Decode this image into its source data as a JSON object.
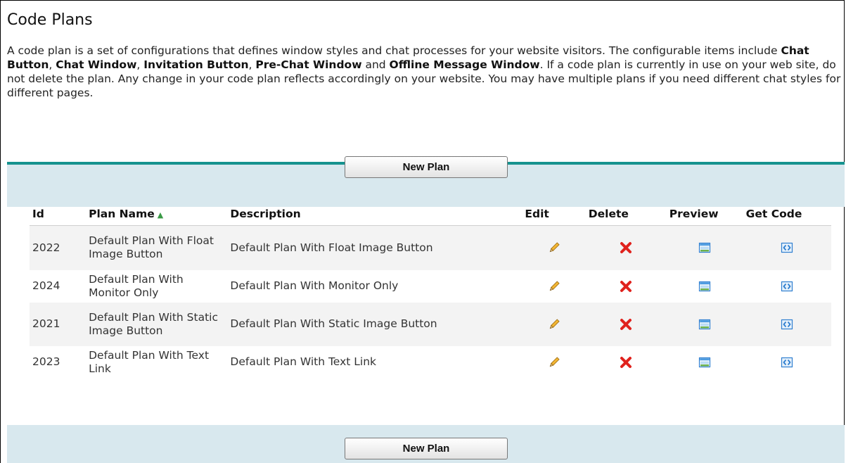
{
  "page": {
    "title": "Code Plans",
    "intro": [
      {
        "text": "A code plan is a set of configurations that defines window styles and chat processes for your website visitors. The configurable items include ",
        "bold": false
      },
      {
        "text": "Chat Button",
        "bold": true
      },
      {
        "text": ", ",
        "bold": false
      },
      {
        "text": "Chat Window",
        "bold": true
      },
      {
        "text": ", ",
        "bold": false
      },
      {
        "text": "Invitation Button",
        "bold": true
      },
      {
        "text": ", ",
        "bold": false
      },
      {
        "text": "Pre-Chat Window",
        "bold": true
      },
      {
        "text": " and ",
        "bold": false
      },
      {
        "text": "Offline Message Window",
        "bold": true
      },
      {
        "text": ". If a code plan is currently in use on your web site, do not delete the plan. Any change in your code plan reflects accordingly on your website. You may have multiple plans if you need different chat styles for different pages.",
        "bold": false
      }
    ]
  },
  "buttons": {
    "new_plan_top": "New Plan",
    "new_plan_bottom": "New Plan"
  },
  "table": {
    "headers": {
      "id": "Id",
      "plan_name": "Plan Name",
      "description": "Description",
      "edit": "Edit",
      "delete": "Delete",
      "preview": "Preview",
      "get_code": "Get Code"
    },
    "sort_indicator": "▲",
    "rows": [
      {
        "id": "2022",
        "plan_name": "Default Plan With Float Image Button",
        "description": "Default Plan With Float Image Button"
      },
      {
        "id": "2024",
        "plan_name": "Default Plan With Monitor Only",
        "description": "Default Plan With Monitor Only"
      },
      {
        "id": "2021",
        "plan_name": "Default Plan With Static Image Button",
        "description": "Default Plan With Static Image Button"
      },
      {
        "id": "2023",
        "plan_name": "Default Plan With Text Link",
        "description": "Default Plan With Text Link"
      }
    ],
    "row_icons": {
      "edit": "pencil-icon",
      "delete": "red-x-icon",
      "preview": "preview-window-icon",
      "get_code": "code-brackets-icon"
    }
  },
  "colors": {
    "accent_line": "#15938f",
    "band_bg": "#d8e8ee",
    "delete_red": "#e0221d",
    "icon_blue": "#2f7fd0"
  }
}
